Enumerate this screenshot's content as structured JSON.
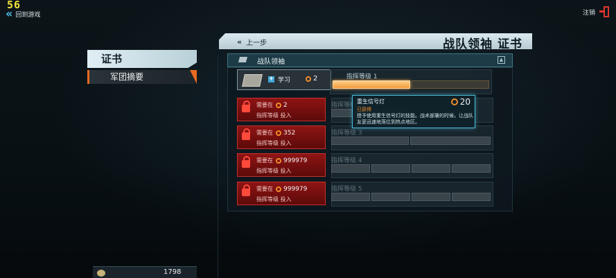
{
  "hud": {
    "fps": "56",
    "back_to_game": "回到游戏",
    "logout": "注销"
  },
  "left_nav": {
    "header": "证书",
    "item": "军团摘要"
  },
  "resource": {
    "value": "1798"
  },
  "panel": {
    "prev_label": "上一步",
    "title": "战队领袖 证书",
    "section_title": "战队领袖"
  },
  "rows": [
    {
      "level_label": "指挥等级 1",
      "learn_label": "学习",
      "cost": "2",
      "filled_bars": 1,
      "total_bars": 2
    },
    {
      "level_label": "指挥等级 2",
      "required_label": "需要在",
      "cost": "2",
      "sub_label": "指挥等级 投入"
    },
    {
      "level_label": "指挥等级 3",
      "required_label": "需要在",
      "cost": "352",
      "sub_label": "指挥等级 投入"
    },
    {
      "level_label": "指挥等级 4",
      "required_label": "需要在",
      "cost": "999979",
      "sub_label": "指挥等级 投入"
    },
    {
      "level_label": "指挥等级 5",
      "required_label": "需要在",
      "cost": "999979",
      "sub_label": "指挥等级 投入"
    }
  ],
  "tooltip": {
    "name": "重生信号灯",
    "status": "已获得",
    "description": "授予使用重生信号灯的技能。战术部署的时候，让战队友更迅速地落位到热点地区。",
    "cost": "20"
  },
  "colors": {
    "accent": "#f08b2a",
    "locked_red": "#8e1414",
    "cyan": "#4fc1dd"
  }
}
